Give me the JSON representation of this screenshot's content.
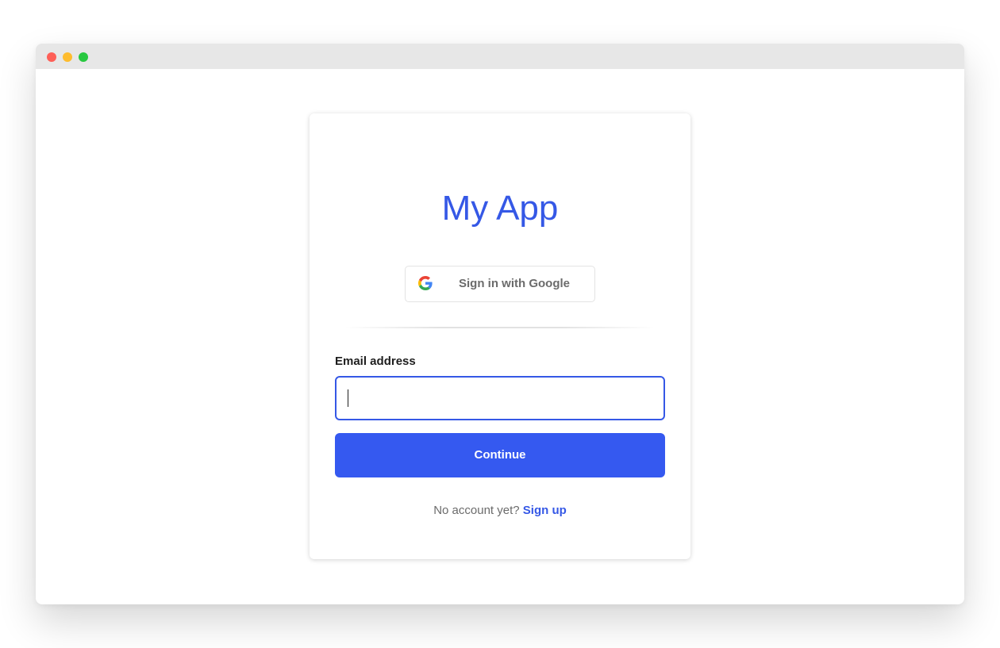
{
  "window": {
    "traffic_lights": [
      "close",
      "minimize",
      "maximize"
    ]
  },
  "login": {
    "title": "My App",
    "google_button_label": "Sign in with Google",
    "google_icon": "google-g-logo",
    "email_label": "Email address",
    "email_value": "",
    "continue_label": "Continue",
    "no_account_text": "No account yet?",
    "signup_label": "Sign up"
  },
  "colors": {
    "accent": "#3558e6",
    "button": "#3559f0",
    "titlebar": "#e7e7e7",
    "close": "#fe5f57",
    "minimize": "#febc2e",
    "maximize": "#28c840"
  }
}
